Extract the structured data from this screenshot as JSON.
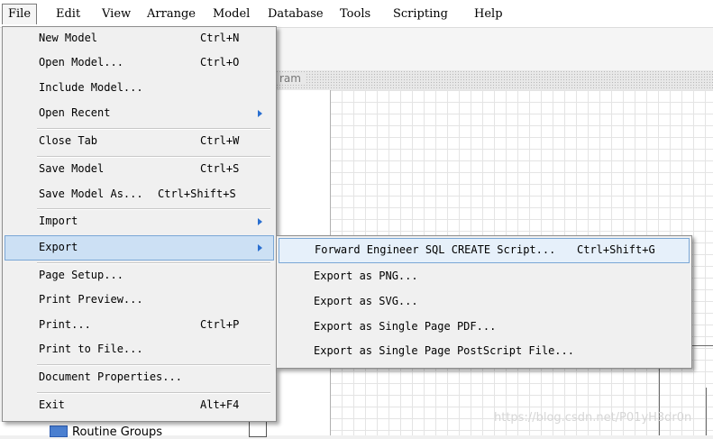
{
  "menubar": {
    "items": [
      "File",
      "Edit",
      "View",
      "Arrange",
      "Model",
      "Database",
      "Tools",
      "Scripting",
      "Help"
    ]
  },
  "document": {
    "title_fragment": "ram"
  },
  "sidebar": {
    "visible_item": "Routine Groups"
  },
  "file_menu": {
    "items": [
      {
        "label": "New Model",
        "shortcut": "Ctrl+N"
      },
      {
        "label": "Open Model...",
        "shortcut": "Ctrl+O"
      },
      {
        "label": "Include Model...",
        "shortcut": ""
      },
      {
        "label": "Open Recent",
        "shortcut": "",
        "submenu": true
      },
      {
        "label": "Close Tab",
        "shortcut": "Ctrl+W"
      },
      {
        "label": "Save Model",
        "shortcut": "Ctrl+S"
      },
      {
        "label": "Save Model As...",
        "shortcut": "Ctrl+Shift+S"
      },
      {
        "label": "Import",
        "shortcut": "",
        "submenu": true
      },
      {
        "label": "Export",
        "shortcut": "",
        "submenu": true,
        "highlighted": true
      },
      {
        "label": "Page Setup...",
        "shortcut": ""
      },
      {
        "label": "Print Preview...",
        "shortcut": ""
      },
      {
        "label": "Print...",
        "shortcut": "Ctrl+P"
      },
      {
        "label": "Print to File...",
        "shortcut": ""
      },
      {
        "label": "Document Properties...",
        "shortcut": ""
      },
      {
        "label": "Exit",
        "shortcut": "Alt+F4"
      }
    ]
  },
  "export_submenu": {
    "items": [
      {
        "label": "Forward Engineer SQL CREATE Script...",
        "shortcut": "Ctrl+Shift+G",
        "highlighted": true
      },
      {
        "label": "Export as PNG...",
        "shortcut": ""
      },
      {
        "label": "Export as SVG...",
        "shortcut": ""
      },
      {
        "label": "Export as Single Page PDF...",
        "shortcut": ""
      },
      {
        "label": "Export as Single Page PostScript File...",
        "shortcut": ""
      }
    ]
  },
  "watermark": "https://blog.csdn.net/P01yH3dr0n",
  "colors": {
    "menu_highlight": "#cce0f4",
    "submenu_arrow": "#2a6fd0"
  }
}
